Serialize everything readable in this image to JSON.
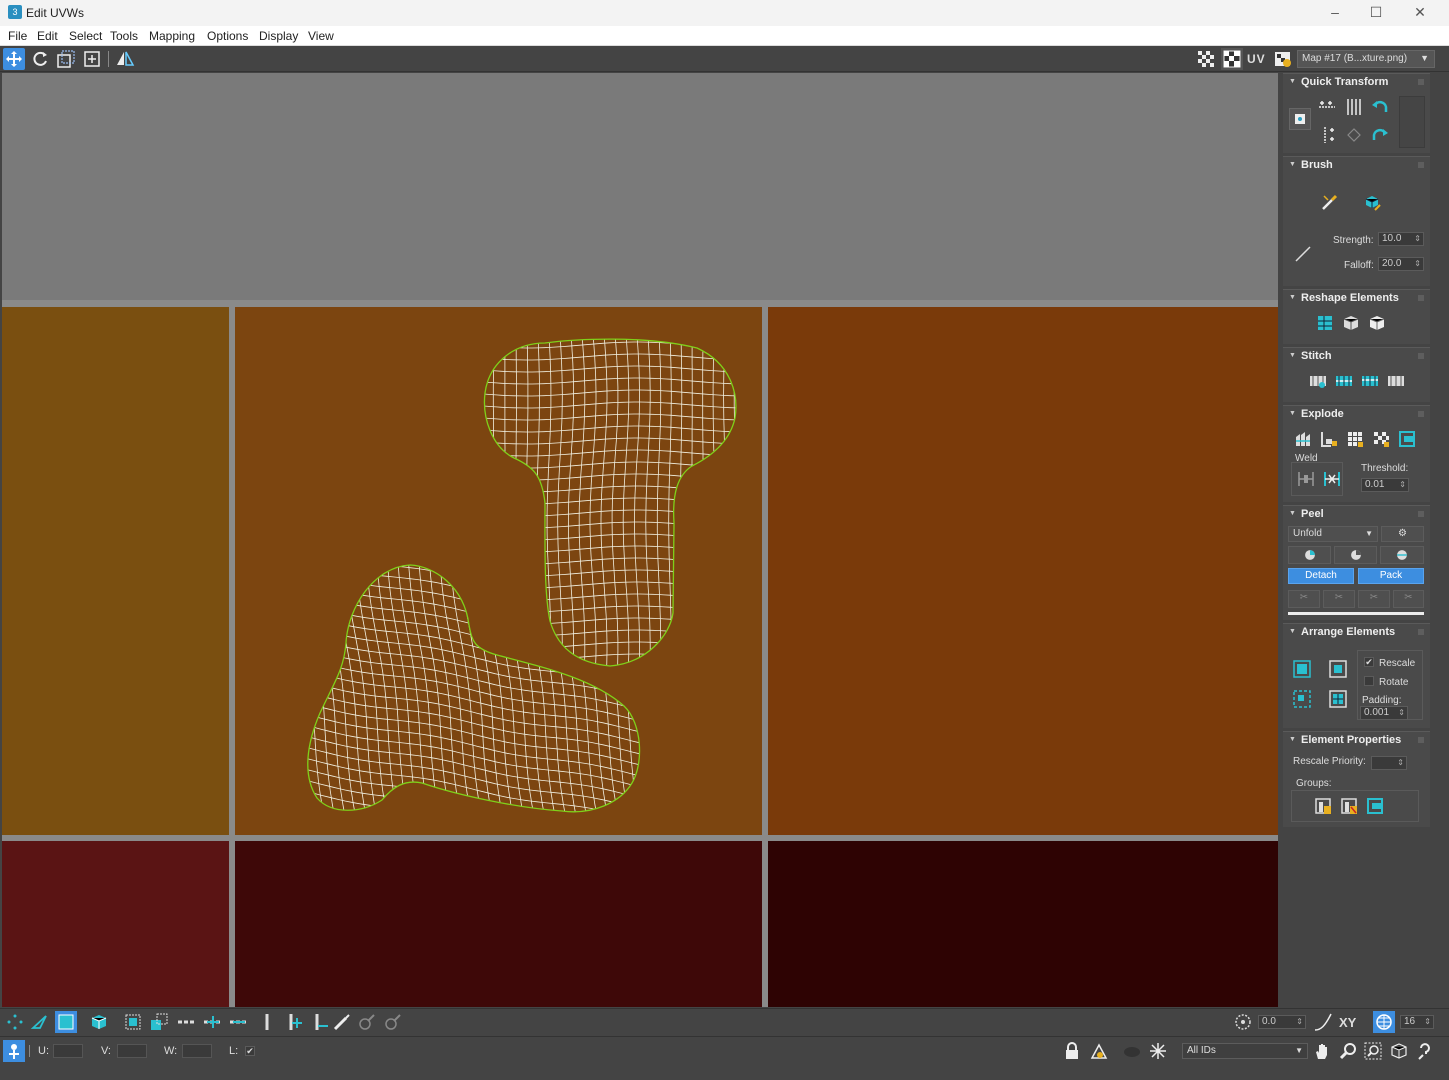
{
  "window": {
    "title": "Edit UVWs",
    "app_icon_text": "3"
  },
  "menu": [
    "File",
    "Edit",
    "Select",
    "Tools",
    "Mapping",
    "Options",
    "Display",
    "View"
  ],
  "toolbar": {
    "uv_label": "UV",
    "map_select": "Map #17 (B...xture.png)",
    "icons": [
      "move-icon",
      "rotate-icon",
      "scale-icon",
      "freeform-icon",
      "mirror-icon",
      "checker-icon",
      "checker-map-icon",
      "settings-map-icon"
    ]
  },
  "colors": {
    "tile_top": "#7a7a7a",
    "tile_mid_left": "#7a4f10",
    "tile_mid_center": "#7c4510",
    "tile_mid_right": "#7a3a0a",
    "tile_bot_left": "#5a1414",
    "tile_bot_center": "#3e0808",
    "tile_bot_right": "#2e0303",
    "grid_line": "#8a8a8a",
    "mesh_wire": "#f2f0e0",
    "mesh_border": "#7fd01a",
    "accent_blue": "#3d8ee0"
  },
  "panel": {
    "quick_transform": {
      "title": "Quick Transform"
    },
    "brush": {
      "title": "Brush",
      "strength_label": "Strength:",
      "strength_value": "10.0",
      "falloff_label": "Falloff:",
      "falloff_value": "20.0"
    },
    "reshape": {
      "title": "Reshape Elements"
    },
    "stitch": {
      "title": "Stitch"
    },
    "explode": {
      "title": "Explode",
      "weld_label": "Weld",
      "threshold_label": "Threshold:",
      "threshold_value": "0.01"
    },
    "peel": {
      "title": "Peel",
      "mode": "Unfold",
      "detach_label": "Detach",
      "pack_label": "Pack"
    },
    "arrange": {
      "title": "Arrange Elements",
      "rescale_label": "Rescale",
      "rescale_checked": "✔",
      "rotate_label": "Rotate",
      "padding_label": "Padding:",
      "padding_value": "0.001"
    },
    "element_props": {
      "title": "Element Properties",
      "rescale_priority_label": "Rescale Priority:",
      "groups_label": "Groups:"
    }
  },
  "bottom": {
    "angle_value": "0.0",
    "xy_label": "XY",
    "grid_value": "16",
    "u_label": "U:",
    "v_label": "V:",
    "w_label": "W:",
    "l_label": "L:",
    "l_checked": "✔",
    "ids_select": "All IDs"
  }
}
